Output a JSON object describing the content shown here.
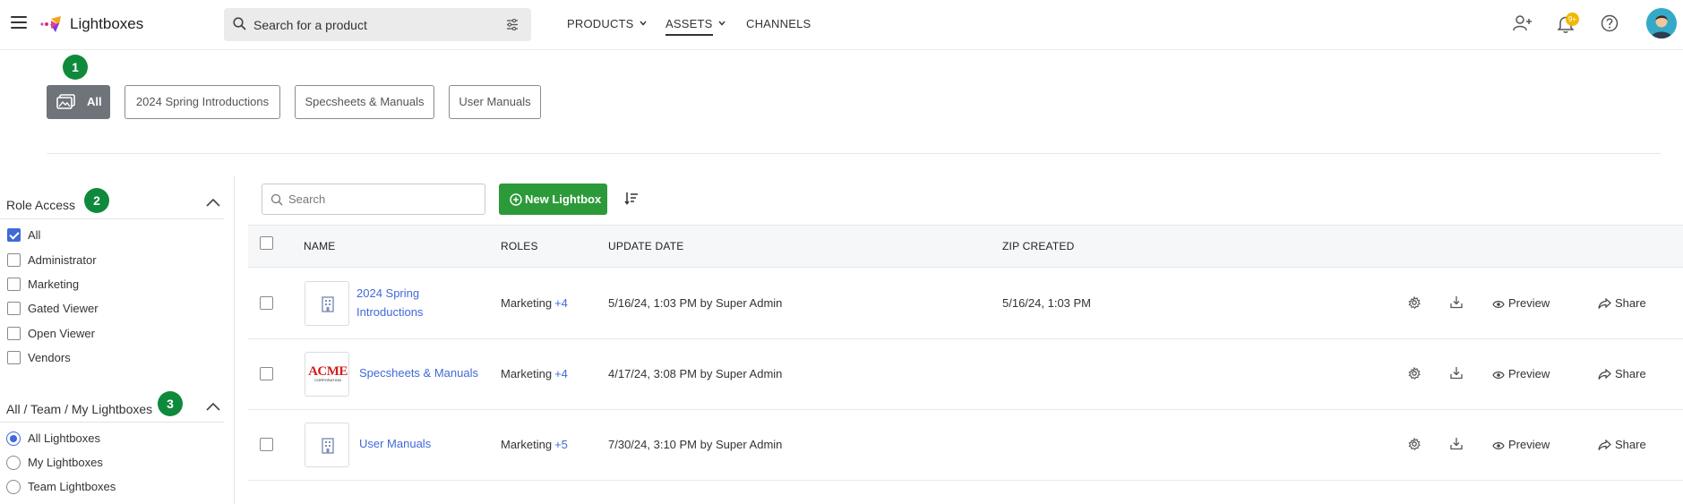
{
  "header": {
    "brand": "Lightboxes",
    "search_placeholder": "Search for a product",
    "nav": [
      {
        "label": "PRODUCTS",
        "dropdown": true,
        "active": false
      },
      {
        "label": "ASSETS",
        "dropdown": true,
        "active": true
      },
      {
        "label": "CHANNELS",
        "dropdown": false,
        "active": false
      }
    ],
    "notification_badge": "9+",
    "icons": [
      "menu-icon",
      "search-icon",
      "filter-icon",
      "add-user-icon",
      "bell-icon",
      "help-icon",
      "avatar"
    ]
  },
  "steps": [
    "1",
    "2",
    "3"
  ],
  "filter_chips": [
    {
      "label": "All",
      "active": true
    },
    {
      "label": "2024 Spring Introductions",
      "active": false
    },
    {
      "label": "Specsheets & Manuals",
      "active": false
    },
    {
      "label": "User Manuals",
      "active": false
    }
  ],
  "sidebar": {
    "role_access": {
      "title": "Role Access",
      "options": [
        {
          "label": "All",
          "checked": true
        },
        {
          "label": "Administrator",
          "checked": false
        },
        {
          "label": "Marketing",
          "checked": false
        },
        {
          "label": "Gated Viewer",
          "checked": false
        },
        {
          "label": "Open Viewer",
          "checked": false
        },
        {
          "label": "Vendors",
          "checked": false
        }
      ]
    },
    "scope": {
      "title": "All / Team / My Lightboxes",
      "options": [
        {
          "label": "All Lightboxes",
          "selected": true
        },
        {
          "label": "My Lightboxes",
          "selected": false
        },
        {
          "label": "Team Lightboxes",
          "selected": false
        }
      ]
    }
  },
  "list": {
    "search_placeholder": "Search",
    "new_button": "New Lightbox",
    "columns": [
      "NAME",
      "ROLES",
      "UPDATE DATE",
      "ZIP CREATED"
    ],
    "rows": [
      {
        "name": "2024 Spring Introductions",
        "thumb": "building-icon",
        "role": "Marketing",
        "more": "+4",
        "update": "5/16/24, 1:03 PM by Super Admin",
        "zip": "5/16/24, 1:03 PM"
      },
      {
        "name": "Specsheets & Manuals",
        "thumb": "acme-logo",
        "thumb_text": [
          "ACME",
          "CORPORATION"
        ],
        "role": "Marketing",
        "more": "+4",
        "update": "4/17/24, 3:08 PM by Super Admin",
        "zip": ""
      },
      {
        "name": "User Manuals",
        "thumb": "building-icon",
        "role": "Marketing",
        "more": "+5",
        "update": "7/30/24, 3:10 PM by Super Admin",
        "zip": ""
      }
    ],
    "actions": {
      "preview": "Preview",
      "share": "Share"
    }
  },
  "colors": {
    "accent_green": "#2d9a3a",
    "step_green": "#0f8a3c",
    "link_blue": "#3f6ad8",
    "chip_active": "#6f737a",
    "badge": "#f2b705"
  }
}
